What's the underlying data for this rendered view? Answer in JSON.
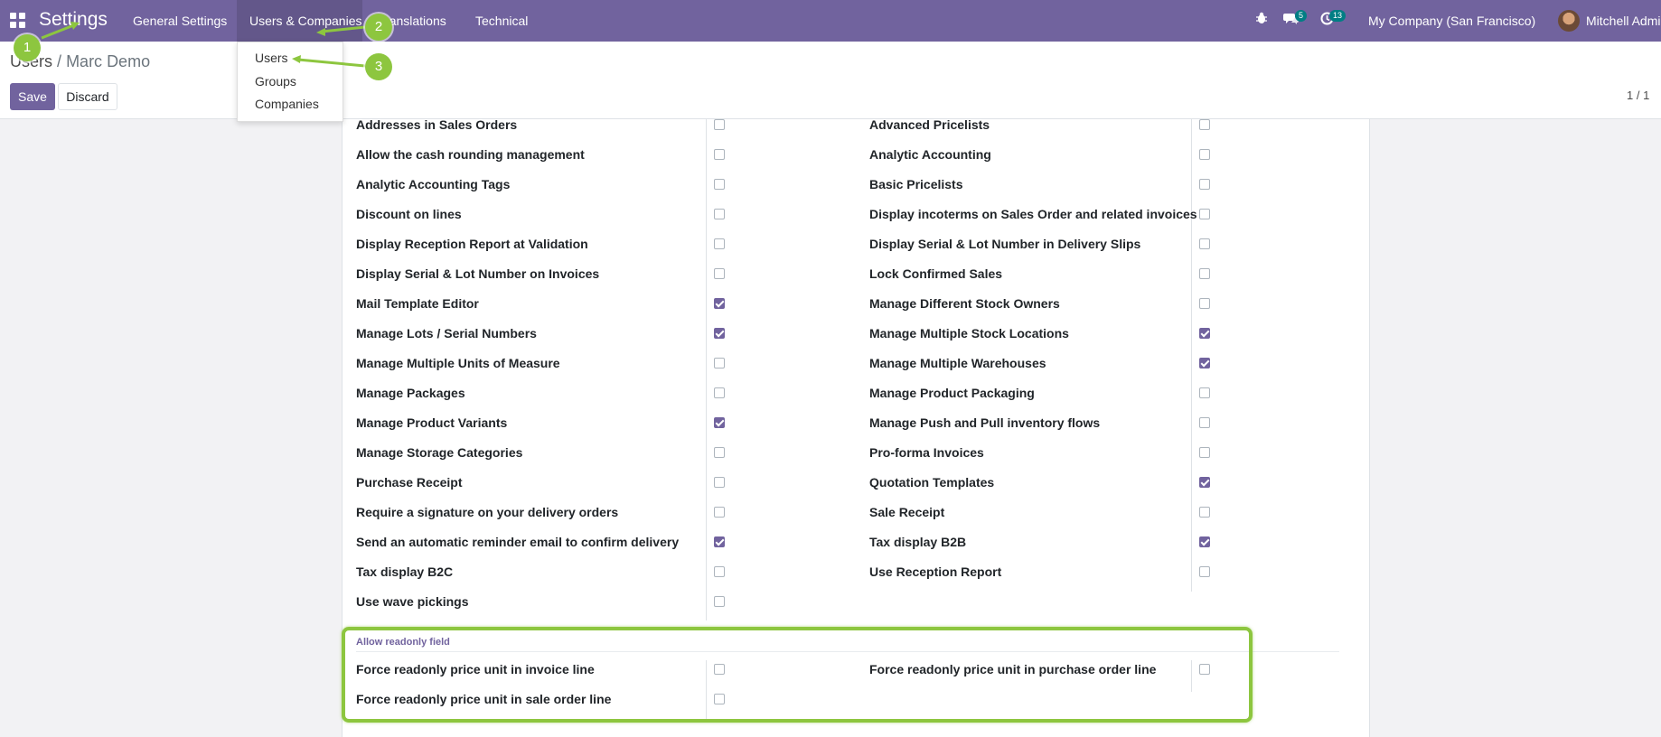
{
  "navbar": {
    "app_title": "Settings",
    "menu": [
      "General Settings",
      "Users & Companies",
      "Translations",
      "Technical"
    ],
    "chat_count": "5",
    "activity_count": "13",
    "company": "My Company (San Francisco)",
    "user": "Mitchell Admin",
    "bar_color": "#71639e"
  },
  "dropdown": {
    "items": [
      "Users",
      "Groups",
      "Companies"
    ]
  },
  "control_panel": {
    "breadcrumb_parent": "Users",
    "breadcrumb_separator": "/",
    "breadcrumb_current": "Marc Demo",
    "save_label": "Save",
    "discard_label": "Discard",
    "pager": "1 / 1"
  },
  "settings": {
    "left": [
      {
        "label": "Addresses in Sales Orders",
        "checked": false
      },
      {
        "label": "Allow the cash rounding management",
        "checked": false
      },
      {
        "label": "Analytic Accounting Tags",
        "checked": false
      },
      {
        "label": "Discount on lines",
        "checked": false
      },
      {
        "label": "Display Reception Report at Validation",
        "checked": false
      },
      {
        "label": "Display Serial & Lot Number on Invoices",
        "checked": false
      },
      {
        "label": "Mail Template Editor",
        "checked": true
      },
      {
        "label": "Manage Lots / Serial Numbers",
        "checked": true
      },
      {
        "label": "Manage Multiple Units of Measure",
        "checked": false
      },
      {
        "label": "Manage Packages",
        "checked": false
      },
      {
        "label": "Manage Product Variants",
        "checked": true
      },
      {
        "label": "Manage Storage Categories",
        "checked": false
      },
      {
        "label": "Purchase Receipt",
        "checked": false
      },
      {
        "label": "Require a signature on your delivery orders",
        "checked": false
      },
      {
        "label": "Send an automatic reminder email to confirm delivery",
        "checked": true
      },
      {
        "label": "Tax display B2C",
        "checked": false
      },
      {
        "label": "Use wave pickings",
        "checked": false
      }
    ],
    "right": [
      {
        "label": "Advanced Pricelists",
        "checked": false
      },
      {
        "label": "Analytic Accounting",
        "checked": false
      },
      {
        "label": "Basic Pricelists",
        "checked": false
      },
      {
        "label": "Display incoterms on Sales Order and related invoices",
        "checked": false
      },
      {
        "label": "Display Serial & Lot Number in Delivery Slips",
        "checked": false
      },
      {
        "label": "Lock Confirmed Sales",
        "checked": false
      },
      {
        "label": "Manage Different Stock Owners",
        "checked": false
      },
      {
        "label": "Manage Multiple Stock Locations",
        "checked": true
      },
      {
        "label": "Manage Multiple Warehouses",
        "checked": true
      },
      {
        "label": "Manage Product Packaging",
        "checked": false
      },
      {
        "label": "Manage Push and Pull inventory flows",
        "checked": false
      },
      {
        "label": "Pro-forma Invoices",
        "checked": false
      },
      {
        "label": "Quotation Templates",
        "checked": true
      },
      {
        "label": "Sale Receipt",
        "checked": false
      },
      {
        "label": "Tax display B2B",
        "checked": true
      },
      {
        "label": "Use Reception Report",
        "checked": false
      }
    ]
  },
  "readonly_section": {
    "title": "Allow readonly field",
    "left": [
      {
        "label": "Force readonly price unit in invoice line",
        "checked": false
      },
      {
        "label": "Force readonly price unit in sale order line",
        "checked": false
      }
    ],
    "right": [
      {
        "label": "Force readonly price unit in purchase order line",
        "checked": false
      }
    ]
  },
  "annotations": {
    "steps": [
      "1",
      "2",
      "3"
    ],
    "color": "#8dc63f"
  }
}
